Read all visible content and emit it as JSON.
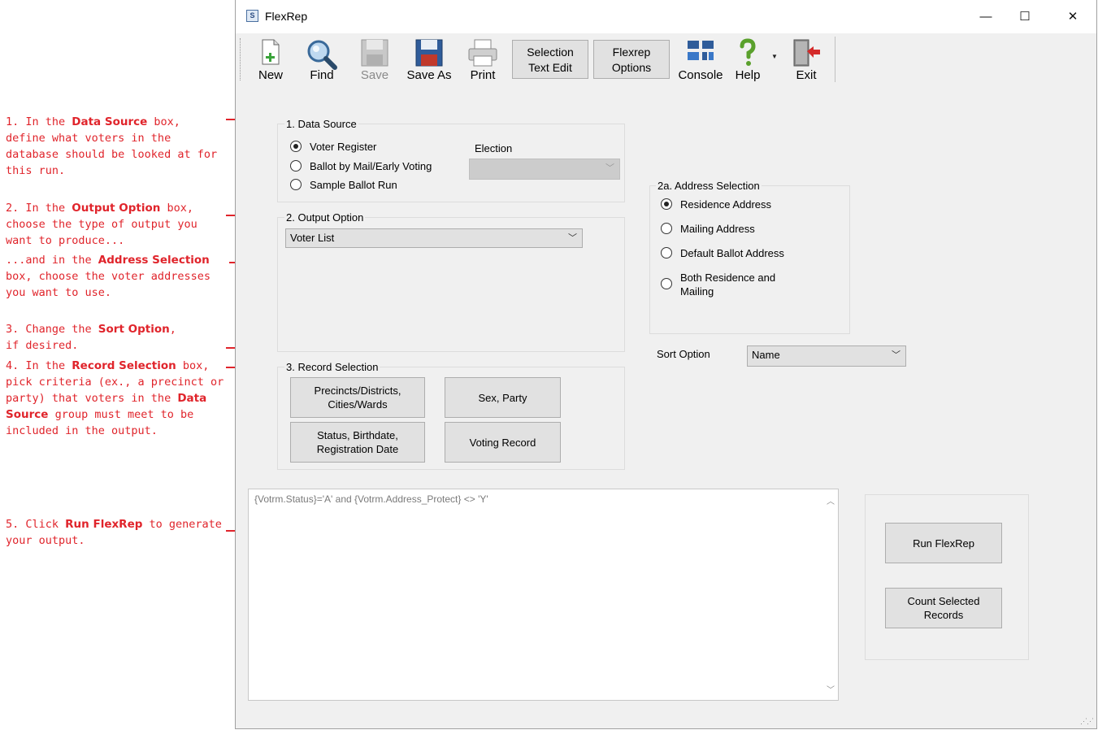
{
  "annotations": {
    "a1": {
      "pre": "1. In the ",
      "bold": "Data Source",
      "post": " box, define what voters in the database should be looked at for this run."
    },
    "a2": {
      "pre": "2. In the ",
      "bold": "Output Option",
      "post": " box, choose the type of output you want to produce..."
    },
    "a2b": {
      "pre": "...and in the ",
      "bold": "Address Selection",
      "post": " box, choose the voter addresses you want to use."
    },
    "a3": {
      "pre": "3. Change the ",
      "bold": "Sort Option",
      "post": ", if desired."
    },
    "a4": {
      "pre": "4. In the ",
      "bold": "Record Selection",
      "post": " box, pick criteria (ex., a precinct or party) that voters in the ",
      "bold2": "Data Source",
      "post2": " group must meet to be included in the output."
    },
    "a5": {
      "pre": "5. Click ",
      "bold": "Run FlexRep",
      "post": " to generate your output."
    }
  },
  "window": {
    "title": "FlexRep",
    "minimize": "—",
    "maximize": "☐",
    "close": "✕"
  },
  "toolbar": {
    "new": "New",
    "find": "Find",
    "save": "Save",
    "save_as": "Save As",
    "print": "Print",
    "selection_text_edit_1": "Selection",
    "selection_text_edit_2": "Text Edit",
    "flexrep_options_1": "Flexrep",
    "flexrep_options_2": "Options",
    "console": "Console",
    "help": "Help",
    "exit": "Exit"
  },
  "data_source": {
    "title": "1.  Data Source",
    "options": [
      "Voter Register",
      "Ballot by Mail/Early Voting",
      "Sample Ballot Run"
    ],
    "selected": 0,
    "election_label": "Election",
    "election_value": ""
  },
  "output_option": {
    "title": "2.  Output Option",
    "value": "Voter List"
  },
  "address_selection": {
    "title": "2a.  Address Selection",
    "options": [
      "Residence Address",
      "Mailing Address",
      "Default Ballot Address",
      "Both Residence and",
      "Mailing"
    ],
    "selected": 0
  },
  "sort": {
    "label": "Sort Option",
    "value": "Name"
  },
  "record_selection": {
    "title": "3.  Record Selection",
    "precincts_1": "Precincts/Districts,",
    "precincts_2": "Cities/Wards",
    "sex_party": "Sex, Party",
    "status_1": "Status, Birthdate,",
    "status_2": "Registration Date",
    "voting_record": "Voting Record"
  },
  "query": {
    "text": "{Votrm.Status}='A' and {Votrm.Address_Protect} <> 'Y'"
  },
  "actions": {
    "run": "Run FlexRep",
    "count_1": "Count Selected",
    "count_2": "Records"
  },
  "colors": {
    "annotation": "#e0242b",
    "window_bg": "#f0f0f0",
    "button_bg": "#e1e1e1"
  }
}
